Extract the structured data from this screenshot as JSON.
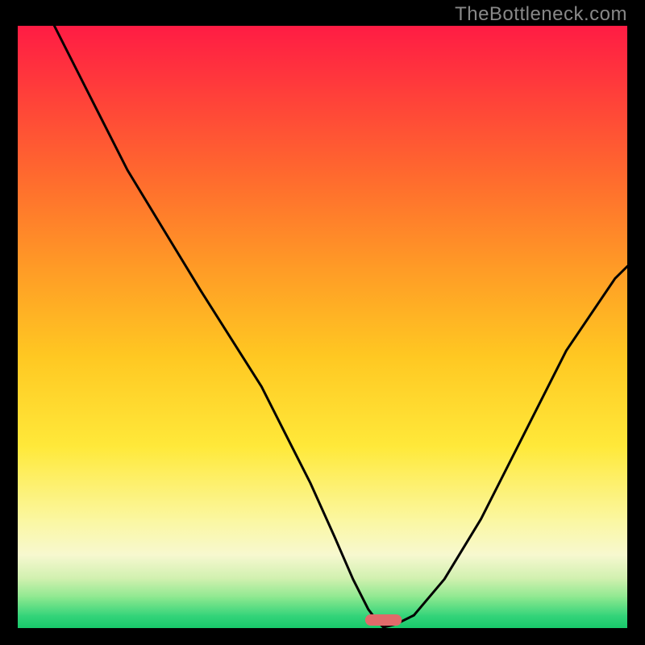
{
  "watermark": "TheBottleneck.com",
  "colors": {
    "frame": "#000000",
    "curve": "#000000",
    "marker": "#e06a6a"
  },
  "chart_data": {
    "type": "line",
    "title": "",
    "xlabel": "",
    "ylabel": "",
    "xlim": [
      0,
      100
    ],
    "ylim": [
      0,
      100
    ],
    "background": {
      "description": "Vertical gradient from red at top through orange and yellow to a narrow green strip at the bottom",
      "stops": [
        {
          "y": 0,
          "color": "#ff1c44"
        },
        {
          "y": 10,
          "color": "#ff3b3b"
        },
        {
          "y": 25,
          "color": "#ff6a2e"
        },
        {
          "y": 40,
          "color": "#ff9a26"
        },
        {
          "y": 55,
          "color": "#ffc822"
        },
        {
          "y": 70,
          "color": "#ffe93a"
        },
        {
          "y": 82,
          "color": "#fbf7a0"
        },
        {
          "y": 88,
          "color": "#f7f8d0"
        },
        {
          "y": 92,
          "color": "#cff0ae"
        },
        {
          "y": 95,
          "color": "#8be88f"
        },
        {
          "y": 98,
          "color": "#35d47a"
        },
        {
          "y": 100,
          "color": "#18c96b"
        }
      ]
    },
    "series": [
      {
        "name": "bottleneck-curve",
        "x": [
          6,
          12,
          18,
          24,
          30,
          35,
          40,
          44,
          48,
          52,
          55,
          57.5,
          59,
          60,
          62,
          65,
          70,
          76,
          83,
          90,
          98,
          100
        ],
        "y": [
          100,
          88,
          76,
          66,
          56,
          48,
          40,
          32,
          24,
          15,
          8,
          3,
          1,
          0,
          0.5,
          2,
          8,
          18,
          32,
          46,
          58,
          60
        ]
      }
    ],
    "annotations": [
      {
        "name": "optimal-marker",
        "shape": "rounded-bar",
        "x": 60,
        "y": 0,
        "width_units": 6,
        "height_units": 2,
        "color": "#e06a6a"
      }
    ]
  }
}
